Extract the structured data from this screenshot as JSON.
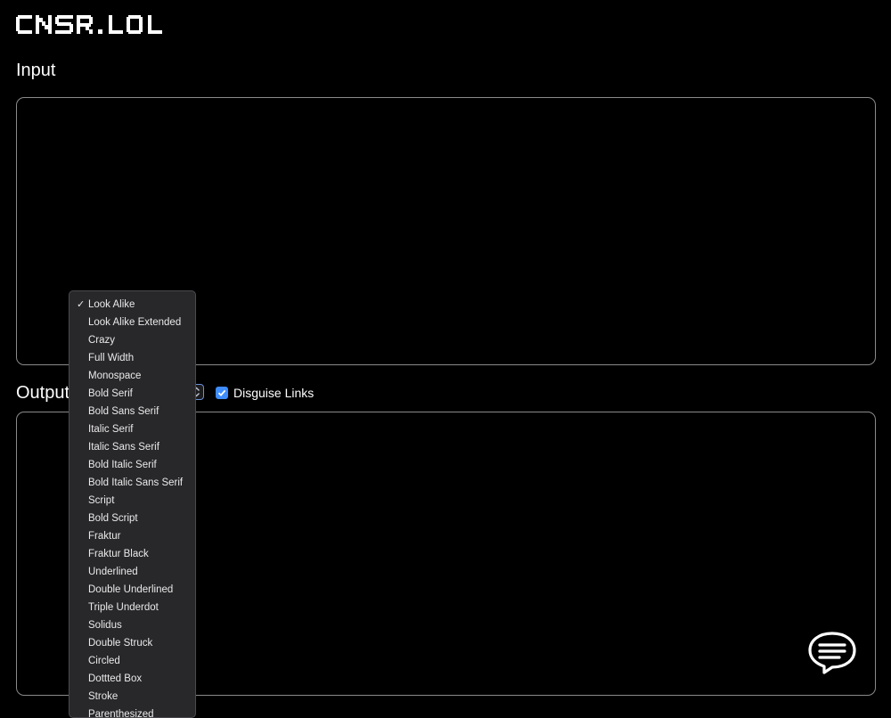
{
  "header": {
    "logo_text": "CNSR.LOL"
  },
  "input": {
    "heading": "Input"
  },
  "output": {
    "heading": "Output",
    "disguise_links_label": "Disguise Links",
    "disguise_links_checked": true
  },
  "style_select": {
    "selected": "Look Alike",
    "options": [
      "Look Alike",
      "Look Alike Extended",
      "Crazy",
      "Full Width",
      "Monospace",
      "Bold Serif",
      "Bold Sans Serif",
      "Italic Serif",
      "Italic Sans Serif",
      "Bold Italic Serif",
      "Bold Italic Sans Serif",
      "Script",
      "Bold Script",
      "Fraktur",
      "Fraktur Black",
      "Underlined",
      "Double Underlined",
      "Triple Underdot",
      "Solidus",
      "Double Struck",
      "Circled",
      "Dottted Box",
      "Stroke",
      "Parenthesized"
    ]
  },
  "colors": {
    "background": "#000000",
    "accent": "#3f8cff",
    "menu_background": "#28272a"
  },
  "icons": {
    "checkbox": "checkmark-icon",
    "selected_option": "checkmark-icon",
    "chat": "chat-bubble-icon"
  }
}
